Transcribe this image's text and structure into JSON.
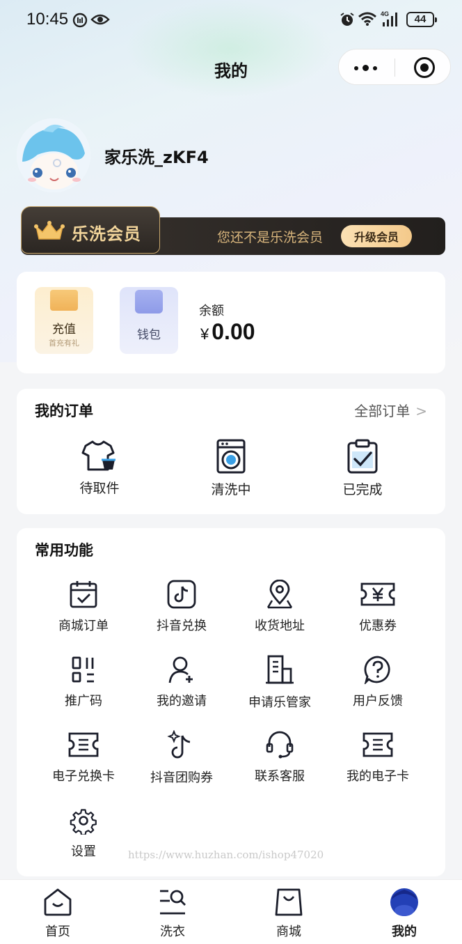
{
  "status_bar": {
    "time": "10:45",
    "battery": "44"
  },
  "nav": {
    "title": "我的"
  },
  "profile": {
    "username": "家乐洗_zKF4"
  },
  "membership": {
    "badge": "乐洗会员",
    "hint": "您还不是乐洗会员",
    "upgrade": "升级会员"
  },
  "wallet": {
    "recharge_label": "充值",
    "recharge_sub": "首充有礼",
    "wallet_label": "钱包",
    "balance_label": "余额",
    "currency": "¥",
    "balance": "0.00"
  },
  "orders": {
    "title": "我的订单",
    "all_label": "全部订单",
    "items": [
      {
        "label": "待取件",
        "icon": "shirt-basket-icon"
      },
      {
        "label": "清洗中",
        "icon": "washing-machine-icon"
      },
      {
        "label": "已完成",
        "icon": "clipboard-check-icon"
      }
    ]
  },
  "functions": {
    "title": "常用功能",
    "items": [
      {
        "label": "商城订单",
        "icon": "calendar-check-icon"
      },
      {
        "label": "抖音兑换",
        "icon": "tiktok-icon"
      },
      {
        "label": "收货地址",
        "icon": "location-pin-icon"
      },
      {
        "label": "优惠券",
        "icon": "yen-coupon-icon"
      },
      {
        "label": "推广码",
        "icon": "qr-code-icon"
      },
      {
        "label": "我的邀请",
        "icon": "user-add-icon"
      },
      {
        "label": "申请乐管家",
        "icon": "building-icon"
      },
      {
        "label": "用户反馈",
        "icon": "question-icon"
      },
      {
        "label": "电子兑换卡",
        "icon": "ticket-icon"
      },
      {
        "label": "抖音团购券",
        "icon": "tiktok-sparkle-icon"
      },
      {
        "label": "联系客服",
        "icon": "headset-icon"
      },
      {
        "label": "我的电子卡",
        "icon": "ticket-icon"
      },
      {
        "label": "设置",
        "icon": "gear-icon"
      }
    ]
  },
  "watermark": "https://www.huzhan.com/ishop47020",
  "tabbar": {
    "items": [
      {
        "label": "首页",
        "icon": "home-icon"
      },
      {
        "label": "洗衣",
        "icon": "laundry-search-icon"
      },
      {
        "label": "商城",
        "icon": "shopping-bag-icon"
      },
      {
        "label": "我的",
        "icon": "profile-icon"
      }
    ],
    "active": "我的"
  },
  "colors": {
    "accent_gold": "#f1d49a",
    "member_dark": "#2b2622",
    "active_blue": "#2340b6"
  }
}
